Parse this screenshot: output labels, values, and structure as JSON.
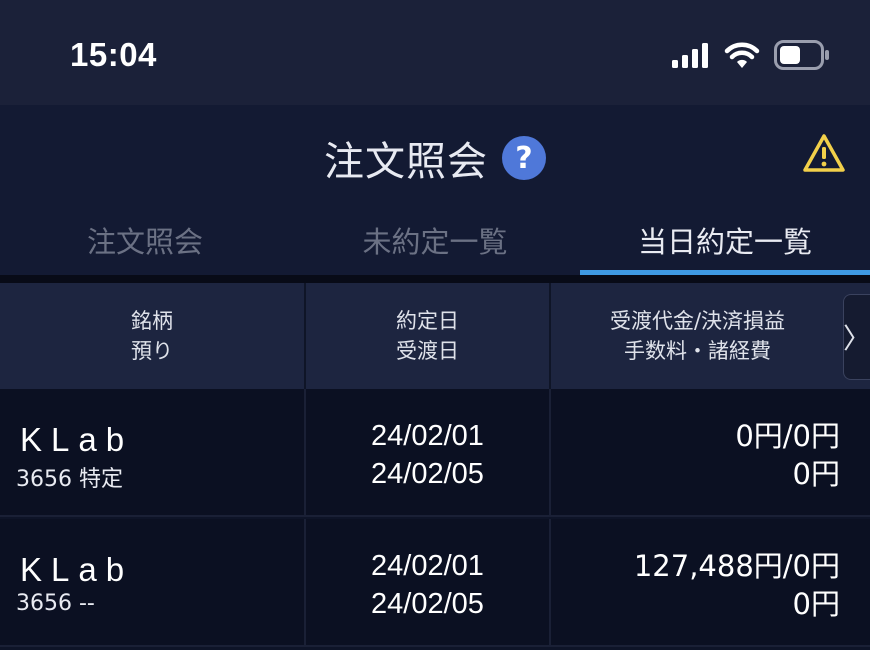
{
  "status": {
    "time": "15:04"
  },
  "header": {
    "title": "注文照会",
    "help_glyph": "?",
    "warning_icon": "warning-icon"
  },
  "tabs": [
    {
      "label": "注文照会",
      "active": false
    },
    {
      "label": "未約定一覧",
      "active": false
    },
    {
      "label": "当日約定一覧",
      "active": true
    }
  ],
  "table": {
    "headers": {
      "col1_line1": "銘柄",
      "col1_line2": "預り",
      "col2_line1": "約定日",
      "col2_line2": "受渡日",
      "col3_line1": "受渡代金/決済損益",
      "col3_line2": "手数料・諸経費",
      "scroll_glyph": "〉"
    },
    "rows": [
      {
        "name": "KLab",
        "sub": "3656 特定",
        "trade_date": "24/02/01",
        "settle_date": "24/02/05",
        "amount": "0円/0円",
        "fee": "0円"
      },
      {
        "name": "KLab",
        "sub": "3656 --",
        "trade_date": "24/02/01",
        "settle_date": "24/02/05",
        "amount": "127,488円/0円",
        "fee": "0円"
      }
    ]
  },
  "colors": {
    "accent": "#3f9ae3",
    "help": "#4f78d9",
    "warning": "#f2d04a"
  }
}
